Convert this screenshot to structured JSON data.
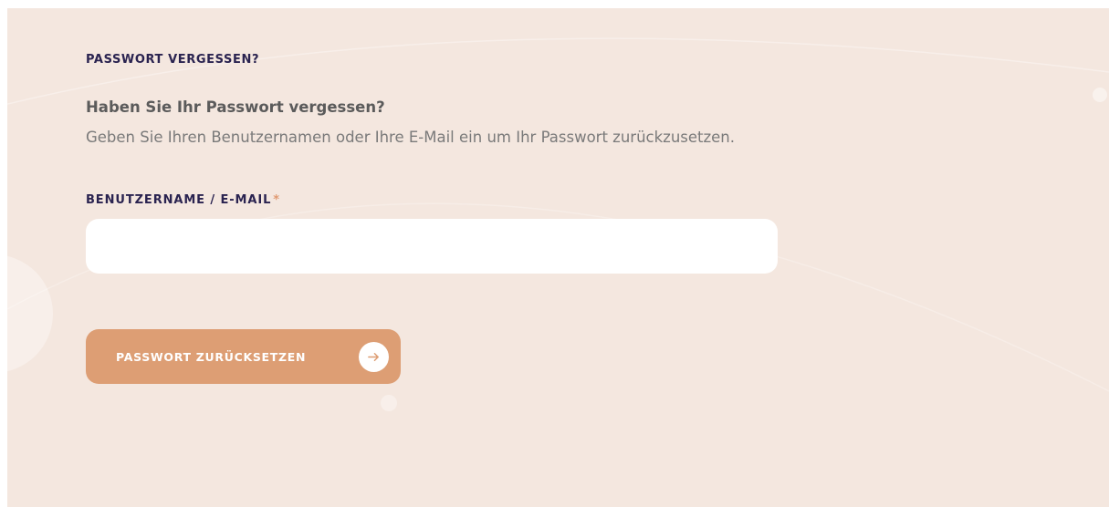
{
  "page": {
    "section_title": "PASSWORT VERGESSEN?",
    "question": "Haben Sie Ihr Passwort vergessen?",
    "description": "Geben Sie Ihren Benutzernamen oder Ihre E-Mail ein um Ihr Passwort zurückzusetzen."
  },
  "form": {
    "username_label": "BENUTZERNAME / E-MAIL",
    "required_marker": "*",
    "username_value": "",
    "username_placeholder": "",
    "submit_label": "PASSWORT ZURÜCKSETZEN",
    "submit_icon": "arrow-right-icon"
  },
  "colors": {
    "background": "#f4e7df",
    "heading": "#2a2350",
    "accent": "#dd9e74",
    "required": "#e09a72"
  }
}
